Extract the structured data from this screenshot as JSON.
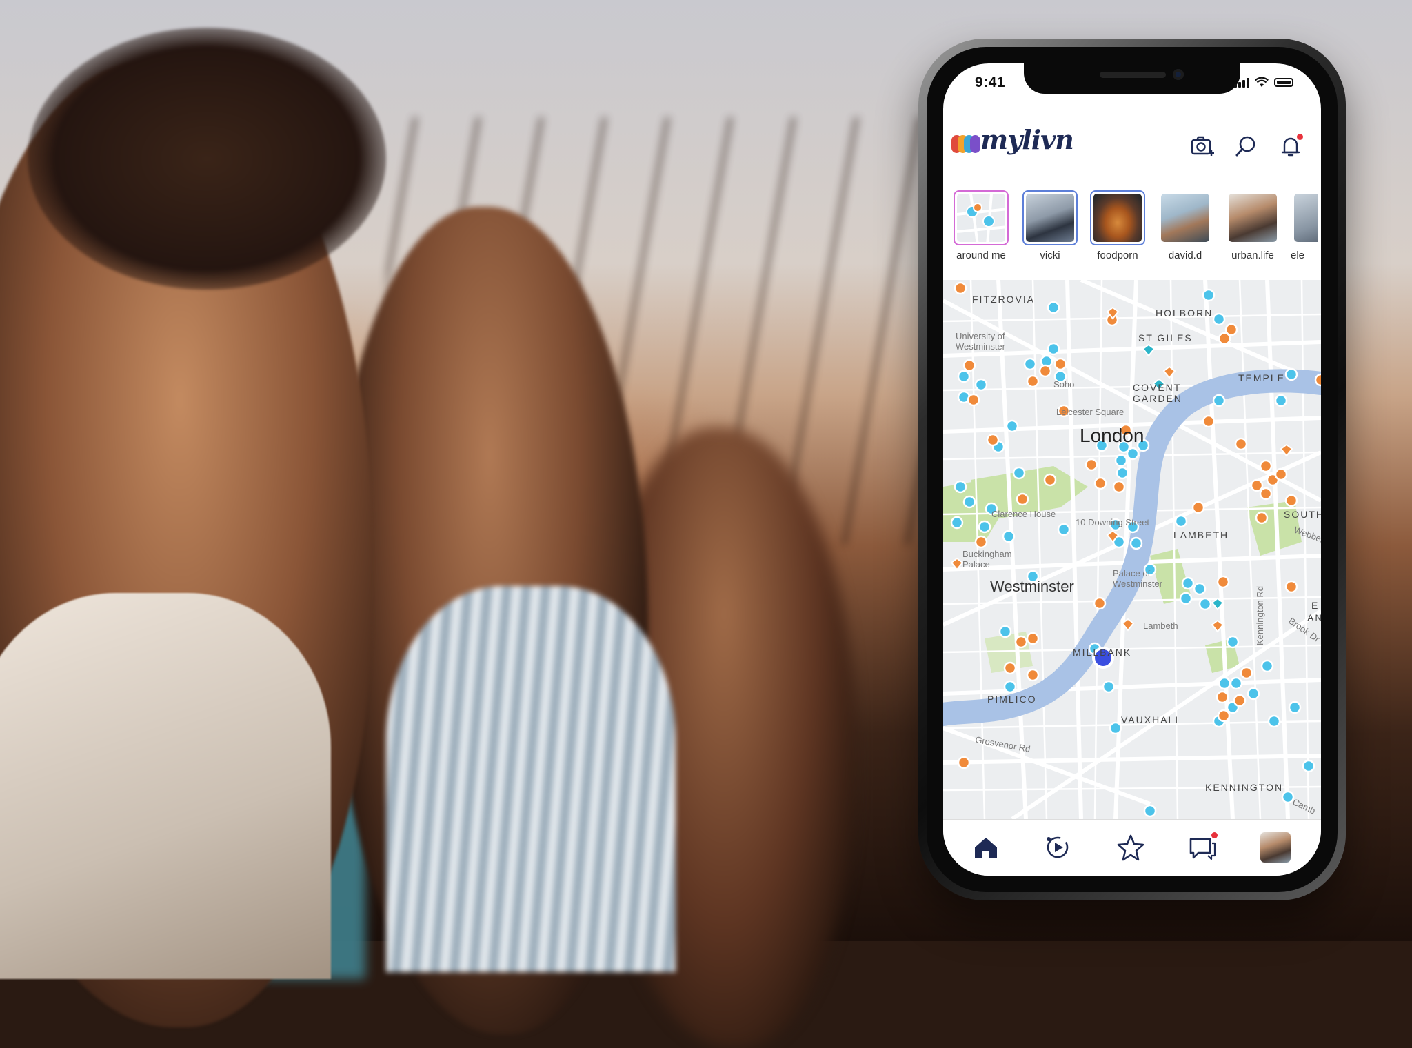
{
  "status_bar": {
    "time": "9:41"
  },
  "app": {
    "logo_text": "mylivn",
    "logo_colors": [
      "#e04a3c",
      "#f2a22c",
      "#3aa7d8",
      "#7a4fc9"
    ]
  },
  "header_icons": [
    "camera-plus-icon",
    "search-icon",
    "bell-icon"
  ],
  "stories": [
    {
      "label": "around me",
      "ring": "pink"
    },
    {
      "label": "vicki",
      "ring": "blue"
    },
    {
      "label": "foodporn",
      "ring": "blue"
    },
    {
      "label": "david.d",
      "ring": "none"
    },
    {
      "label": "urban.life",
      "ring": "none"
    },
    {
      "label": "ele",
      "ring": "none"
    }
  ],
  "map": {
    "place_labels": [
      "FITZROVIA",
      "HOLBORN",
      "ST GILES",
      "University of Westminster",
      "COVENT GARDEN",
      "TEMPLE",
      "Leicester Square",
      "London",
      "Clarence House",
      "10 Downing Street",
      "LAMBETH",
      "SOUTH",
      "Buckingham Palace",
      "Palace of Westminster",
      "Westminster",
      "Lambeth",
      "MILLBANK",
      "Kennington Rd",
      "PIMLICO",
      "VAUXHALL",
      "Grosvenor Rd",
      "KENNINGTON",
      "Brook Dr",
      "Webber",
      "E",
      "AN",
      "Camb",
      "Soho"
    ]
  },
  "tab_bar": [
    "home-icon",
    "stories-play-icon",
    "star-icon",
    "chat-icon",
    "profile-avatar"
  ],
  "colors": {
    "brand_navy": "#1e2a55",
    "pin_blue": "#4cc3ea",
    "pin_orange": "#f08a3a",
    "river": "#a9c2e6",
    "park": "#c9e2a8",
    "user_location": "#3a4ee0"
  }
}
